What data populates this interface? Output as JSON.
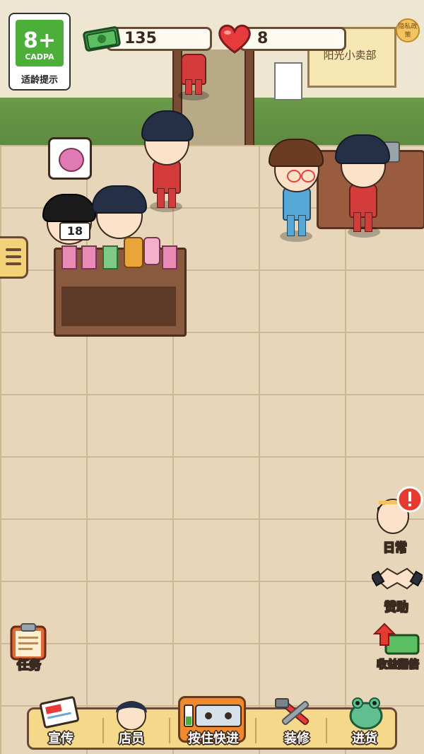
{
  "hud": {
    "cash_value": "135",
    "hearts_value": "8"
  },
  "age_rating": {
    "rating": "8+",
    "org": "CADPA",
    "tip": "适龄提示"
  },
  "shop_sign": {
    "text": "阳光小卖部"
  },
  "privacy": {
    "label": "隐私政策"
  },
  "customer_queue_number": "18",
  "side_buttons": {
    "daily": "日常",
    "sponsor": "赞助",
    "double_income": "收益翻倍",
    "task": "任务"
  },
  "bottom_nav": {
    "promote": "宣传",
    "staff": "店员",
    "fast_forward": "按住快进",
    "decorate": "装修",
    "restock": "进货"
  },
  "colors": {
    "accent": "#f4d98a",
    "outline": "#6b4a35",
    "alert": "#e53b2f",
    "cash_green": "#3e9b45",
    "heart_red": "#e53b3b"
  }
}
